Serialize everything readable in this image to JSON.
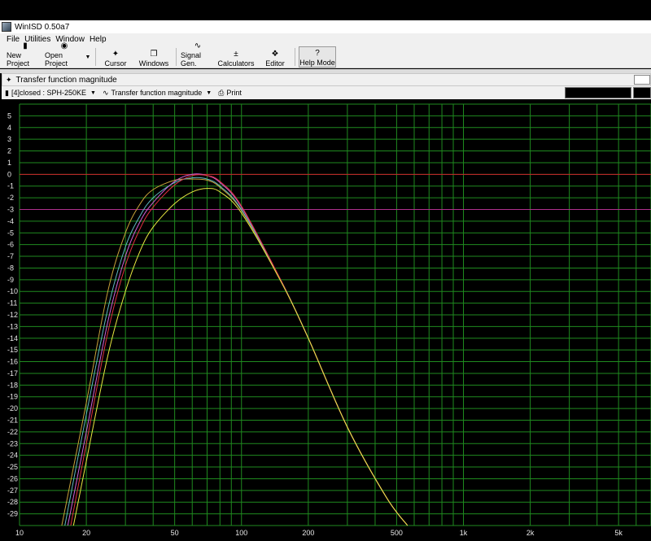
{
  "window": {
    "title": "WinISD 0.50a7"
  },
  "menu": [
    {
      "label": "File"
    },
    {
      "label": "Utilities"
    },
    {
      "label": "Window"
    },
    {
      "label": "Help"
    }
  ],
  "toolbar": {
    "new_project": "New Project",
    "open_project": "Open Project",
    "cursor": "Cursor",
    "windows": "Windows",
    "signal_gen": "Signal Gen.",
    "calculators": "Calculators",
    "editor": "Editor",
    "help_mode": "Help Mode"
  },
  "panel": {
    "title": "Transfer function magnitude",
    "project_select": "[4]closed : SPH-250KE",
    "graph_select": "Transfer function magnitude",
    "print": "Print"
  },
  "chart_data": {
    "type": "line",
    "title": "",
    "xlabel": "",
    "ylabel": "",
    "xscale": "log",
    "xlim": [
      10,
      7000
    ],
    "ylim": [
      -30,
      6
    ],
    "x_tick_labels": [
      "10",
      "20",
      "50",
      "100",
      "200",
      "500",
      "1k",
      "2k",
      "5k"
    ],
    "x_tick_values": [
      10,
      20,
      50,
      100,
      200,
      500,
      1000,
      2000,
      5000
    ],
    "y_tick_values": [
      5,
      4,
      3,
      2,
      1,
      0,
      -1,
      -2,
      -3,
      -4,
      -5,
      -6,
      -7,
      -8,
      -9,
      -10,
      -11,
      -12,
      -13,
      -14,
      -15,
      -16,
      -17,
      -18,
      -19,
      -20,
      -21,
      -22,
      -23,
      -24,
      -25,
      -26,
      -27,
      -28,
      -29
    ],
    "grid": true,
    "reference_lines": [
      {
        "y": 0,
        "color": "#cc1f2a"
      },
      {
        "y": -3,
        "color": "#b0308e"
      }
    ],
    "series": [
      {
        "color": "#c8a23a",
        "x": [
          15.5,
          20,
          25,
          30,
          35,
          40,
          50,
          60,
          70,
          80,
          100,
          150,
          200,
          300,
          450,
          560
        ],
        "y": [
          -30,
          -19.5,
          -10,
          -5,
          -2.5,
          -1.3,
          -0.5,
          -0.4,
          -0.5,
          -1.1,
          -3.1,
          -9,
          -14,
          -21.6,
          -27.6,
          -30
        ]
      },
      {
        "color": "#5fb8c2",
        "x": [
          16,
          20,
          25,
          30,
          35,
          40,
          50,
          60,
          70,
          80,
          100,
          150,
          200,
          300,
          450,
          560
        ],
        "y": [
          -30,
          -20.5,
          -11.5,
          -6.2,
          -3.5,
          -2,
          -0.7,
          -0.3,
          -0.4,
          -1,
          -3,
          -9,
          -14,
          -21.6,
          -27.6,
          -30
        ]
      },
      {
        "color": "#d060d8",
        "x": [
          16.5,
          20,
          25,
          30,
          35,
          40,
          50,
          60,
          70,
          80,
          100,
          150,
          200,
          300,
          450,
          560
        ],
        "y": [
          -30,
          -22,
          -12.6,
          -7,
          -4,
          -2.4,
          -0.6,
          0,
          -0.1,
          -0.7,
          -2.8,
          -9,
          -14,
          -21.6,
          -27.6,
          -30
        ]
      },
      {
        "color": "#e03040",
        "x": [
          17,
          20,
          25,
          30,
          35,
          40,
          50,
          60,
          70,
          80,
          100,
          150,
          200,
          300,
          450,
          560
        ],
        "y": [
          -30,
          -23,
          -13.5,
          -7.8,
          -4.6,
          -2.8,
          -0.9,
          -0.1,
          -0.1,
          -0.6,
          -2.7,
          -9,
          -14,
          -21.6,
          -27.6,
          -30
        ]
      },
      {
        "color": "#e8e840",
        "x": [
          17.5,
          20,
          25,
          30,
          35,
          40,
          50,
          60,
          70,
          80,
          100,
          150,
          200,
          300,
          450,
          560
        ],
        "y": [
          -30,
          -24.5,
          -15.5,
          -10,
          -6.5,
          -4.5,
          -2.5,
          -1.5,
          -1.2,
          -1.5,
          -3.3,
          -9.1,
          -14,
          -21.6,
          -27.6,
          -30
        ]
      }
    ],
    "grid_color": "#1f8a1f",
    "background_color": "#000000"
  }
}
